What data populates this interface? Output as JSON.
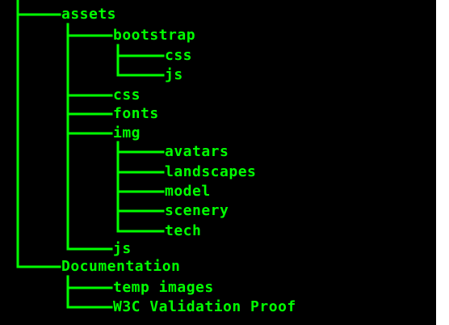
{
  "colors": {
    "background": "#000000",
    "text": "#00ff00",
    "margin": "#ffffff"
  },
  "tree": {
    "assets": {
      "label": "assets",
      "bootstrap": {
        "label": "bootstrap",
        "css": "css",
        "js": "js"
      },
      "css": "css",
      "fonts": "fonts",
      "img": {
        "label": "img",
        "avatars": "avatars",
        "landscapes": "landscapes",
        "model": "model",
        "scenery": "scenery",
        "tech": "tech"
      },
      "js": "js"
    },
    "documentation": {
      "label": "Documentation",
      "temp_images": "temp images",
      "w3c": "W3C Validation Proof"
    }
  }
}
